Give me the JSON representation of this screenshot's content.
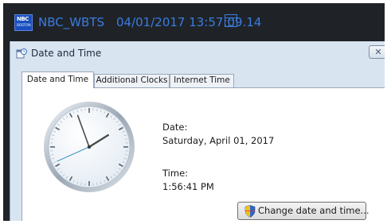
{
  "station": {
    "name": "NBC_WBTS",
    "datetime": "04/01/2017 13:57:09.14",
    "logo_text": "NBC BOSTON",
    "logo_line1": "NBC",
    "logo_line2": "BOSTON"
  },
  "dialog": {
    "title": "Date and Time",
    "close_symbol": "✕",
    "tabs": [
      {
        "label": "Date and Time",
        "active": true
      },
      {
        "label": "Additional Clocks",
        "active": false
      },
      {
        "label": "Internet Time",
        "active": false
      }
    ],
    "date_label": "Date:",
    "date_value": "Saturday, April 01, 2017",
    "time_label": "Time:",
    "time_value": "1:56:41 PM",
    "change_button": "Change date and time..."
  },
  "clock": {
    "hours": 1,
    "minutes": 56,
    "seconds": 41
  },
  "colors": {
    "station_text": "#3b7ce0",
    "dark_background": "#1f2327",
    "dialog_background": "#d9e4f1"
  },
  "icons": [
    "nbc-logo-icon",
    "calendar-icon",
    "date-time-icon",
    "close-icon",
    "shield-icon"
  ]
}
